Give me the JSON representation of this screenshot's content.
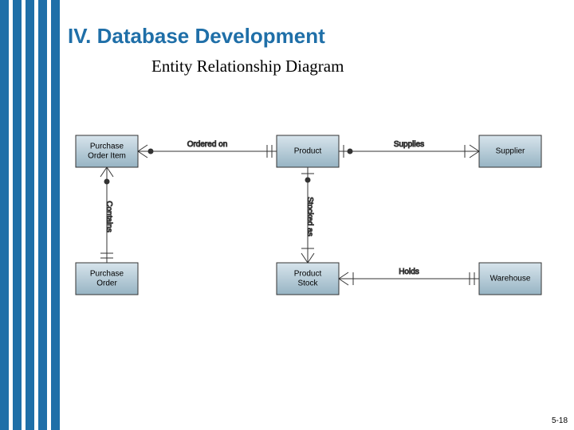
{
  "header": {
    "title": "IV. Database Development",
    "subtitle": "Entity Relationship Diagram"
  },
  "entities": {
    "poi": "Purchase Order Item",
    "product": "Product",
    "supplier": "Supplier",
    "po": "Purchase Order",
    "pstock": "Product Stock",
    "warehouse": "Warehouse"
  },
  "relationships": {
    "ordered_on": "Ordered on",
    "supplies": "Supplies",
    "contains": "Contains",
    "stocked_as": "Stocked as",
    "holds": "Holds"
  },
  "page_number": "5-18"
}
